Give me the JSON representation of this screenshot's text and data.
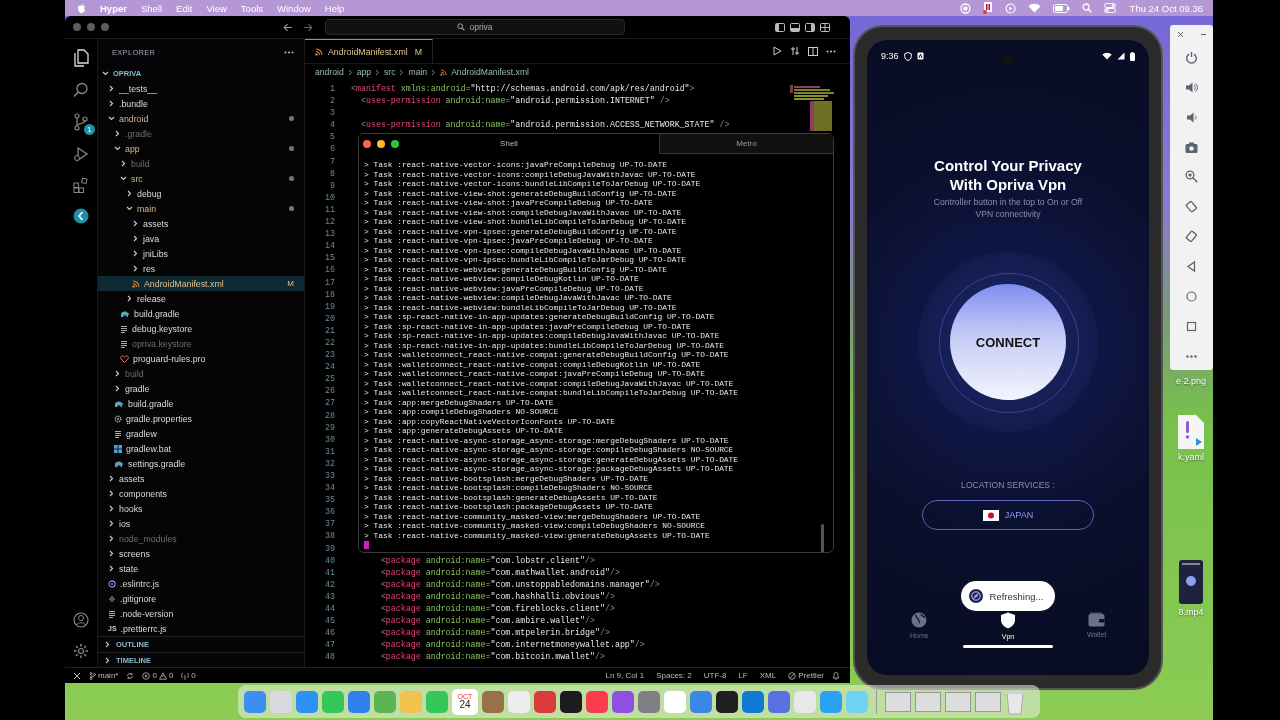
{
  "menu_bar": {
    "app": "Hyper",
    "items": [
      "Shell",
      "Edit",
      "View",
      "Tools",
      "Window",
      "Help"
    ],
    "clock": "Thu 24 Oct 09.36"
  },
  "vscode": {
    "search": "opriva",
    "activity_bar": {
      "badge": "1"
    },
    "explorer": {
      "title": "EXPLORER",
      "workspace": {
        "name": "OPRIVA",
        "expanded": true
      },
      "tree": [
        {
          "name": "__tests__",
          "kind": "folder",
          "expanded": false,
          "dimmed": false,
          "dot": false,
          "selected": false
        },
        {
          "name": ".bundle",
          "kind": "folder",
          "expanded": false,
          "dimmed": false,
          "dot": false,
          "selected": false
        },
        {
          "name": "android",
          "kind": "folder",
          "expanded": true,
          "dimmed": false,
          "dot": true,
          "selected": false,
          "children": [
            {
              "name": ".gradle",
              "kind": "folder",
              "expanded": false,
              "dimmed": true,
              "dot": false,
              "selected": false
            },
            {
              "name": "app",
              "kind": "folder",
              "expanded": true,
              "dimmed": false,
              "dot": true,
              "selected": false,
              "children": [
                {
                  "name": "build",
                  "kind": "folder",
                  "expanded": false,
                  "dimmed": true,
                  "dot": false,
                  "selected": false
                },
                {
                  "name": "src",
                  "kind": "folder",
                  "expanded": true,
                  "dimmed": false,
                  "dot": true,
                  "selected": false,
                  "children": [
                    {
                      "name": "debug",
                      "kind": "folder",
                      "expanded": false,
                      "dimmed": false,
                      "dot": false,
                      "selected": false
                    },
                    {
                      "name": "main",
                      "kind": "folder",
                      "expanded": true,
                      "dimmed": false,
                      "dot": true,
                      "selected": false,
                      "children": [
                        {
                          "name": "assets",
                          "kind": "folder",
                          "expanded": false,
                          "dimmed": false,
                          "dot": false,
                          "selected": false
                        },
                        {
                          "name": "java",
                          "kind": "folder",
                          "expanded": false,
                          "dimmed": false,
                          "dot": false,
                          "selected": false
                        },
                        {
                          "name": "jniLibs",
                          "kind": "folder",
                          "expanded": false,
                          "dimmed": false,
                          "dot": false,
                          "selected": false
                        },
                        {
                          "name": "res",
                          "kind": "folder",
                          "expanded": false,
                          "dimmed": false,
                          "dot": false,
                          "selected": false
                        },
                        {
                          "name": "AndroidManifest.xml",
                          "kind": "xml",
                          "dimmed": false,
                          "dot": false,
                          "selected": true,
                          "badge": "M"
                        }
                      ]
                    },
                    {
                      "name": "release",
                      "kind": "folder",
                      "expanded": false,
                      "dimmed": false,
                      "dot": false,
                      "selected": false
                    }
                  ]
                },
                {
                  "name": "build.gradle",
                  "kind": "gradle",
                  "dimmed": false,
                  "dot": false,
                  "selected": false
                },
                {
                  "name": "debug.keystore",
                  "kind": "text",
                  "dimmed": false,
                  "dot": false,
                  "selected": false
                },
                {
                  "name": "opriva.keystore",
                  "kind": "text",
                  "dimmed": true,
                  "dot": false,
                  "selected": false
                },
                {
                  "name": "proguard-rules.pro",
                  "kind": "proguard",
                  "dimmed": false,
                  "dot": false,
                  "selected": false
                }
              ]
            },
            {
              "name": "build",
              "kind": "folder",
              "expanded": false,
              "dimmed": true,
              "dot": false,
              "selected": false
            },
            {
              "name": "gradle",
              "kind": "folder",
              "expanded": false,
              "dimmed": false,
              "dot": false,
              "selected": false
            },
            {
              "name": "build.gradle",
              "kind": "gradle",
              "dimmed": false,
              "dot": false,
              "selected": false
            },
            {
              "name": "gradle.properties",
              "kind": "settings",
              "dimmed": false,
              "dot": false,
              "selected": false
            },
            {
              "name": "gradlew",
              "kind": "text",
              "dimmed": false,
              "dot": false,
              "selected": false
            },
            {
              "name": "gradlew.bat",
              "kind": "windows",
              "dimmed": false,
              "dot": false,
              "selected": false
            },
            {
              "name": "settings.gradle",
              "kind": "gradle",
              "dimmed": false,
              "dot": false,
              "selected": false
            }
          ]
        },
        {
          "name": "assets",
          "kind": "folder",
          "expanded": false,
          "dimmed": false,
          "dot": false,
          "selected": false
        },
        {
          "name": "components",
          "kind": "folder",
          "expanded": false,
          "dimmed": false,
          "dot": false,
          "selected": false
        },
        {
          "name": "hooks",
          "kind": "folder",
          "expanded": false,
          "dimmed": false,
          "dot": false,
          "selected": false
        },
        {
          "name": "ios",
          "kind": "folder",
          "expanded": false,
          "dimmed": false,
          "dot": false,
          "selected": false
        },
        {
          "name": "node_modules",
          "kind": "folder",
          "expanded": false,
          "dimmed": true,
          "dot": false,
          "selected": false
        },
        {
          "name": "screens",
          "kind": "folder",
          "expanded": false,
          "dimmed": false,
          "dot": false,
          "selected": false
        },
        {
          "name": "state",
          "kind": "folder",
          "expanded": false,
          "dimmed": false,
          "dot": false,
          "selected": false
        },
        {
          "name": ".eslintrc.js",
          "kind": "eslint",
          "dimmed": false,
          "dot": false,
          "selected": false
        },
        {
          "name": ".gitignore",
          "kind": "git",
          "dimmed": false,
          "dot": false,
          "selected": false
        },
        {
          "name": ".node-version",
          "kind": "text",
          "dimmed": false,
          "dot": false,
          "selected": false
        },
        {
          "name": ".prettierrc.js",
          "kind": "js",
          "icon_text": "JS",
          "dimmed": false,
          "dot": false,
          "selected": false
        }
      ],
      "sections": [
        {
          "label": "OUTLINE",
          "expanded": false
        },
        {
          "label": "TIMELINE",
          "expanded": false
        }
      ]
    },
    "tab": {
      "label": "AndroidManifest.xml",
      "badge": "M"
    },
    "breadcrumbs": [
      "android",
      "app",
      "src",
      "main",
      "AndroidManifest.xml"
    ],
    "code_lines": [
      {
        "number": "1",
        "text": "<manifest xmlns:android=\"http://schemas.android.com/apk/res/android\">"
      },
      {
        "number": "2",
        "text": "  <uses-permission android:name=\"android.permission.INTERNET\" />"
      },
      {
        "number": "3"
      },
      {
        "number": "4",
        "text": "  <uses-permission android:name=\"android.permission.ACCESS_NETWORK_STATE\" />"
      },
      {
        "number": "5"
      },
      {
        "number": "6"
      },
      {
        "number": "7"
      },
      {
        "number": "8"
      },
      {
        "number": "9"
      },
      {
        "number": "10"
      },
      {
        "number": "11"
      },
      {
        "number": "12"
      },
      {
        "number": "13"
      },
      {
        "number": "14"
      },
      {
        "number": "15"
      },
      {
        "number": "16"
      },
      {
        "number": "17"
      },
      {
        "number": "18"
      },
      {
        "number": "19"
      },
      {
        "number": "20"
      },
      {
        "number": "21"
      },
      {
        "number": "22"
      },
      {
        "number": "23"
      },
      {
        "number": "24"
      },
      {
        "number": "25"
      },
      {
        "number": "26"
      },
      {
        "number": "27"
      },
      {
        "number": "28"
      },
      {
        "number": "29"
      },
      {
        "number": "30"
      },
      {
        "number": "31"
      },
      {
        "number": "32"
      },
      {
        "number": "33"
      },
      {
        "number": "34"
      },
      {
        "number": "35"
      },
      {
        "number": "36"
      },
      {
        "number": "37"
      },
      {
        "number": "38"
      },
      {
        "number": "39"
      },
      {
        "number": "40",
        "text": "      <package android:name=\"com.lobstr.client\"/>"
      },
      {
        "number": "41",
        "text": "      <package android:name=\"com.mathwallet.android\"/>"
      },
      {
        "number": "42",
        "text": "      <package android:name=\"com.unstoppabledomains.manager\"/>"
      },
      {
        "number": "43",
        "text": "      <package android:name=\"com.hashhalli.obvious\"/>"
      },
      {
        "number": "44",
        "text": "      <package android:name=\"com.fireblocks.client\"/>"
      },
      {
        "number": "45",
        "text": "      <package android:name=\"com.ambire.wallet\"/>"
      },
      {
        "number": "46",
        "text": "      <package android:name=\"com.mtpelerin.bridge\"/>"
      },
      {
        "number": "47",
        "text": "      <package android:name=\"com.internetmoneywallet.app\"/>"
      },
      {
        "number": "48",
        "text": "      <package android:name=\"com.bitcoin.mwallet\"/>"
      }
    ],
    "status_bar": {
      "branch": "main*",
      "errors": "0",
      "warnings": "0",
      "ports": "0",
      "items": [
        "Ln 9, Col 1",
        "Spaces: 2",
        "UTF-8",
        "LF",
        "XML"
      ],
      "formatter": "Prettier"
    }
  },
  "terminal": {
    "tabs": [
      {
        "label": "Shell",
        "selected": true
      },
      {
        "label": "Metro",
        "selected": false
      }
    ],
    "lines": [
      "> Task :react-native-vector-icons:javaPreCompileDebug UP-TO-DATE",
      "> Task :react-native-vector-icons:compileDebugJavaWithJavac UP-TO-DATE",
      "> Task :react-native-vector-icons:bundleLibCompileToJarDebug UP-TO-DATE",
      "> Task :react-native-view-shot:generateDebugBuildConfig UP-TO-DATE",
      "> Task :react-native-view-shot:javaPreCompileDebug UP-TO-DATE",
      "> Task :react-native-view-shot:compileDebugJavaWithJavac UP-TO-DATE",
      "> Task :react-native-view-shot:bundleLibCompileToJarDebug UP-TO-DATE",
      "> Task :react-native-vpn-ipsec:generateDebugBuildConfig UP-TO-DATE",
      "> Task :react-native-vpn-ipsec:javaPreCompileDebug UP-TO-DATE",
      "> Task :react-native-vpn-ipsec:compileDebugJavaWithJavac UP-TO-DATE",
      "> Task :react-native-vpn-ipsec:bundleLibCompileToJarDebug UP-TO-DATE",
      "> Task :react-native-webview:generateDebugBuildConfig UP-TO-DATE",
      "> Task :react-native-webview:compileDebugKotlin UP-TO-DATE",
      "> Task :react-native-webview:javaPreCompileDebug UP-TO-DATE",
      "> Task :react-native-webview:compileDebugJavaWithJavac UP-TO-DATE",
      "> Task :react-native-webview:bundleLibCompileToJarDebug UP-TO-DATE",
      "> Task :sp-react-native-in-app-updates:generateDebugBuildConfig UP-TO-DATE",
      "> Task :sp-react-native-in-app-updates:javaPreCompileDebug UP-TO-DATE",
      "> Task :sp-react-native-in-app-updates:compileDebugJavaWithJavac UP-TO-DATE",
      "> Task :sp-react-native-in-app-updates:bundleLibCompileToJarDebug UP-TO-DATE",
      "> Task :walletconnect_react-native-compat:generateDebugBuildConfig UP-TO-DATE",
      "> Task :walletconnect_react-native-compat:compileDebugKotlin UP-TO-DATE",
      "> Task :walletconnect_react-native-compat:javaPreCompileDebug UP-TO-DATE",
      "> Task :walletconnect_react-native-compat:compileDebugJavaWithJavac UP-TO-DATE",
      "> Task :walletconnect_react-native-compat:bundleLibCompileToJarDebug UP-TO-DATE",
      "> Task :app:mergeDebugShaders UP-TO-DATE",
      "> Task :app:compileDebugShaders NO-SOURCE",
      "> Task :app:copyReactNativeVectorIconFonts UP-TO-DATE",
      "> Task :app:generateDebugAssets UP-TO-DATE",
      "> Task :react-native-async-storage_async-storage:mergeDebugShaders UP-TO-DATE",
      "> Task :react-native-async-storage_async-storage:compileDebugShaders NO-SOURCE",
      "> Task :react-native-async-storage_async-storage:generateDebugAssets UP-TO-DATE",
      "> Task :react-native-async-storage_async-storage:packageDebugAssets UP-TO-DATE",
      "> Task :react-native-bootsplash:mergeDebugShaders UP-TO-DATE",
      "> Task :react-native-bootsplash:compileDebugShaders NO-SOURCE",
      "> Task :react-native-bootsplash:generateDebugAssets UP-TO-DATE",
      "> Task :react-native-bootsplash:packageDebugAssets UP-TO-DATE",
      "> Task :react-native-community_masked-view:mergeDebugShaders UP-TO-DATE",
      "> Task :react-native-community_masked-view:compileDebugShaders NO-SOURCE",
      "> Task :react-native-community_masked-view:generateDebugAssets UP-TO-DATE"
    ]
  },
  "phone": {
    "time": "9:36",
    "title": "Control Your Privacy With Opriva Vpn",
    "subtitle": "Controller button in the top to On or Off VPN connectivity",
    "connect": "CONNECT",
    "location_label": "LOCATION SERVICES :",
    "location": "JAPAN",
    "toast": "Refreshing...",
    "nav": [
      {
        "label": "Home",
        "kind": "globe",
        "selected": false
      },
      {
        "label": "Vpn",
        "kind": "shield",
        "selected": true
      },
      {
        "label": "Wallet",
        "kind": "wallet",
        "selected": false
      }
    ]
  },
  "desktop_files": [
    {
      "label": "e 2.png",
      "kind": "image"
    },
    {
      "label": "k.yaml",
      "kind": "yaml"
    },
    {
      "label": "8.mp4",
      "kind": "video"
    }
  ],
  "dock": {
    "calendar_month": "OCT",
    "calendar_day": "24"
  }
}
